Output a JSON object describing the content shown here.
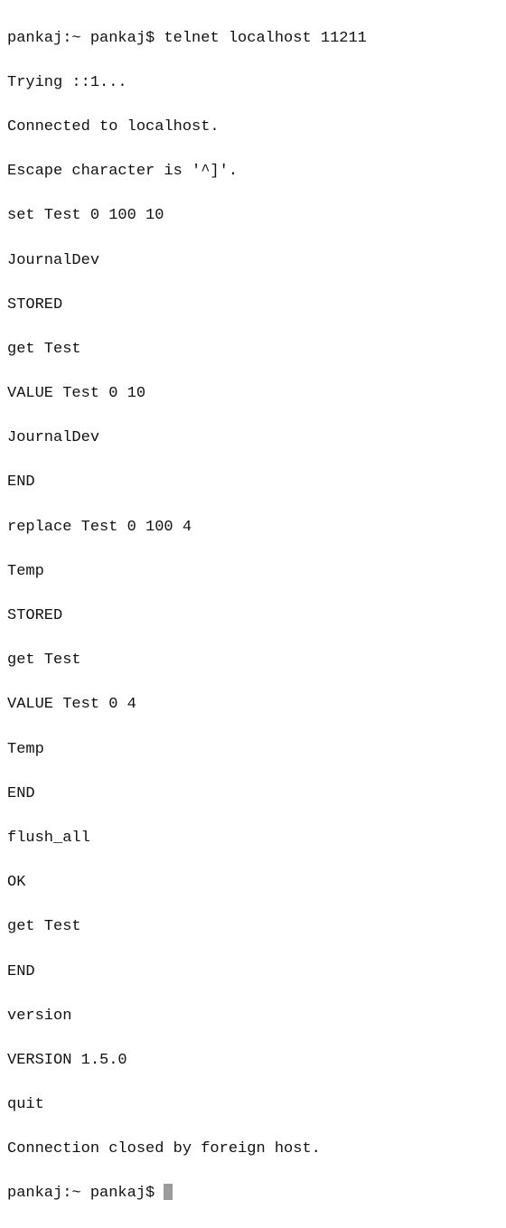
{
  "session": {
    "prompt_prefix": "pankaj:~ pankaj$ ",
    "command": "telnet localhost 11211",
    "final_prompt": "pankaj:~ pankaj$ "
  },
  "lines": {
    "l1": "Trying ::1...",
    "l2": "Connected to localhost.",
    "l3": "Escape character is '^]'.",
    "l4": "set Test 0 100 10",
    "l5": "JournalDev",
    "l6": "STORED",
    "l7": "get Test",
    "l8": "VALUE Test 0 10",
    "l9": "JournalDev",
    "l10": "END",
    "l11": "replace Test 0 100 4",
    "l12": "Temp",
    "l13": "STORED",
    "l14": "get Test",
    "l15": "VALUE Test 0 4",
    "l16": "Temp",
    "l17": "END",
    "l18": "flush_all",
    "l19": "OK",
    "l20": "get Test",
    "l21": "END",
    "l22": "version",
    "l23": "VERSION 1.5.0",
    "l24": "quit",
    "l25": "Connection closed by foreign host."
  }
}
